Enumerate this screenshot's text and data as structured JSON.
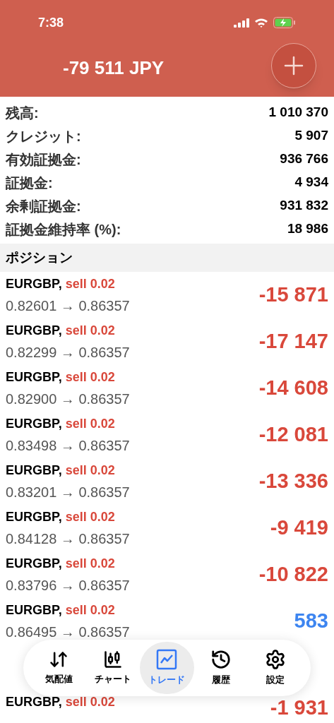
{
  "status_bar": {
    "time": "7:38"
  },
  "header": {
    "balance": "-79 511 JPY"
  },
  "summary": [
    {
      "label": "残高:",
      "value": "1 010 370"
    },
    {
      "label": "クレジット:",
      "value": "5 907"
    },
    {
      "label": "有効証拠金:",
      "value": "936 766"
    },
    {
      "label": "証拠金:",
      "value": "4 934"
    },
    {
      "label": "余剰証拠金:",
      "value": "931 832"
    },
    {
      "label": "証拠金維持率 (%):",
      "value": "18 986"
    }
  ],
  "positions": {
    "title": "ポジション",
    "rows": [
      {
        "pair": "EURGBP,",
        "side": "sell 0.02",
        "prices": "0.82601 → 0.86357",
        "profit": "-15 871",
        "kind": "loss"
      },
      {
        "pair": "EURGBP,",
        "side": "sell 0.02",
        "prices": "0.82299 → 0.86357",
        "profit": "-17 147",
        "kind": "loss"
      },
      {
        "pair": "EURGBP,",
        "side": "sell 0.02",
        "prices": "0.82900 → 0.86357",
        "profit": "-14 608",
        "kind": "loss"
      },
      {
        "pair": "EURGBP,",
        "side": "sell 0.02",
        "prices": "0.83498 → 0.86357",
        "profit": "-12 081",
        "kind": "loss"
      },
      {
        "pair": "EURGBP,",
        "side": "sell 0.02",
        "prices": "0.83201 → 0.86357",
        "profit": "-13 336",
        "kind": "loss"
      },
      {
        "pair": "EURGBP,",
        "side": "sell 0.02",
        "prices": "0.84128 → 0.86357",
        "profit": "-9 419",
        "kind": "loss"
      },
      {
        "pair": "EURGBP,",
        "side": "sell 0.02",
        "prices": "0.83796 → 0.86357",
        "profit": "-10 822",
        "kind": "loss"
      },
      {
        "pair": "EURGBP,",
        "side": "sell 0.02",
        "prices": "0.86495 → 0.86357",
        "profit": "583",
        "kind": "gain"
      },
      {
        "pair": "EURGBP,",
        "side": "sell 0.02",
        "profit": "-1 931",
        "kind": "loss"
      }
    ]
  },
  "tab_bar": [
    {
      "label": "気配値",
      "selected": false
    },
    {
      "label": "チャート",
      "selected": false
    },
    {
      "label": "トレード",
      "selected": true
    },
    {
      "label": "履歴",
      "selected": false
    },
    {
      "label": "設定",
      "selected": false
    }
  ]
}
